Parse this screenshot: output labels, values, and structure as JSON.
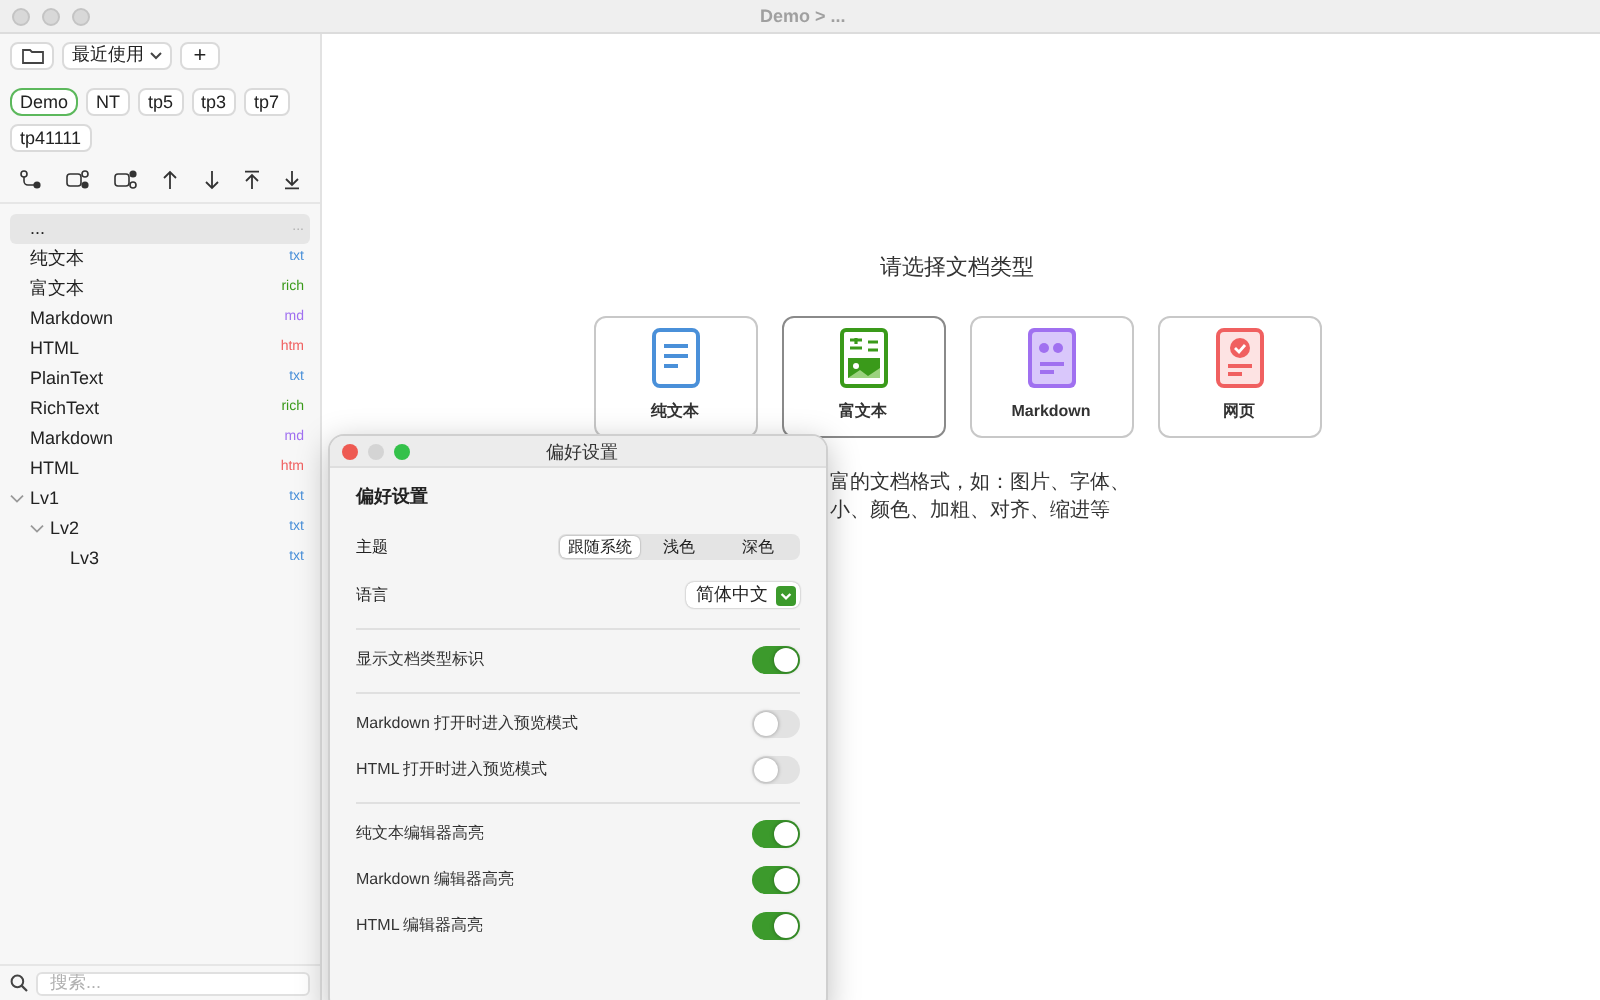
{
  "window": {
    "title": "Demo > ..."
  },
  "sidebar": {
    "recent": "最近使用",
    "add": "+",
    "workspaces": [
      {
        "label": "Demo",
        "selected": true
      },
      {
        "label": "NT",
        "selected": false
      },
      {
        "label": "tp5",
        "selected": false
      },
      {
        "label": "tp3",
        "selected": false
      },
      {
        "label": "tp7",
        "selected": false
      },
      {
        "label": "tp41111",
        "selected": false
      }
    ],
    "files": [
      {
        "name": "...",
        "tag": "...",
        "color": "#b0b0b0",
        "selected": true
      },
      {
        "name": "纯文本",
        "tag": "txt",
        "color": "#4a90d9",
        "selected": false
      },
      {
        "name": "富文本",
        "tag": "rich",
        "color": "#3a9a1a",
        "selected": false
      },
      {
        "name": "Markdown",
        "tag": "md",
        "color": "#a070f0",
        "selected": false
      },
      {
        "name": "HTML",
        "tag": "htm",
        "color": "#f06060",
        "selected": false
      },
      {
        "name": "PlainText",
        "tag": "txt",
        "color": "#4a90d9",
        "selected": false
      },
      {
        "name": "RichText",
        "tag": "rich",
        "color": "#3a9a1a",
        "selected": false
      },
      {
        "name": "Markdown",
        "tag": "md",
        "color": "#a070f0",
        "selected": false
      },
      {
        "name": "HTML",
        "tag": "htm",
        "color": "#f06060",
        "selected": false
      },
      {
        "name": "Lv1",
        "tag": "txt",
        "color": "#4a90d9",
        "selected": false,
        "expanded": true,
        "children": [
          {
            "name": "Lv2",
            "tag": "txt",
            "color": "#4a90d9",
            "selected": false,
            "expanded": true,
            "children": [
              {
                "name": "Lv3",
                "tag": "txt",
                "color": "#4a90d9",
                "selected": false
              }
            ]
          }
        ]
      }
    ],
    "search": {
      "placeholder": "搜索..."
    }
  },
  "main": {
    "prompt": "请选择文档类型",
    "doc_types": [
      {
        "label": "纯文本",
        "kind": "plain",
        "selected": false
      },
      {
        "label": "富文本",
        "kind": "rich",
        "selected": true
      },
      {
        "label": "Markdown",
        "kind": "markdown",
        "selected": false
      },
      {
        "label": "网页",
        "kind": "web",
        "selected": false
      }
    ],
    "description": [
      "富的文档格式，如：图片、字体、",
      "小、颜色、加粗、对齐、缩进等"
    ]
  },
  "preferences": {
    "title": "偏好设置",
    "heading": "偏好设置",
    "theme": {
      "label": "主题",
      "options": [
        {
          "label": "跟随系统",
          "selected": true
        },
        {
          "label": "浅色",
          "selected": false
        },
        {
          "label": "深色",
          "selected": false
        }
      ]
    },
    "language": {
      "label": "语言",
      "value": "简体中文"
    },
    "groups": [
      [
        {
          "label": "显示文档类型标识",
          "on": true
        }
      ],
      [
        {
          "label": "Markdown 打开时进入预览模式",
          "on": false
        },
        {
          "label": "HTML 打开时进入预览模式",
          "on": false
        }
      ],
      [
        {
          "label": "纯文本编辑器高亮",
          "on": true
        },
        {
          "label": "Markdown 编辑器高亮",
          "on": true
        },
        {
          "label": "HTML 编辑器高亮",
          "on": true
        }
      ]
    ]
  }
}
